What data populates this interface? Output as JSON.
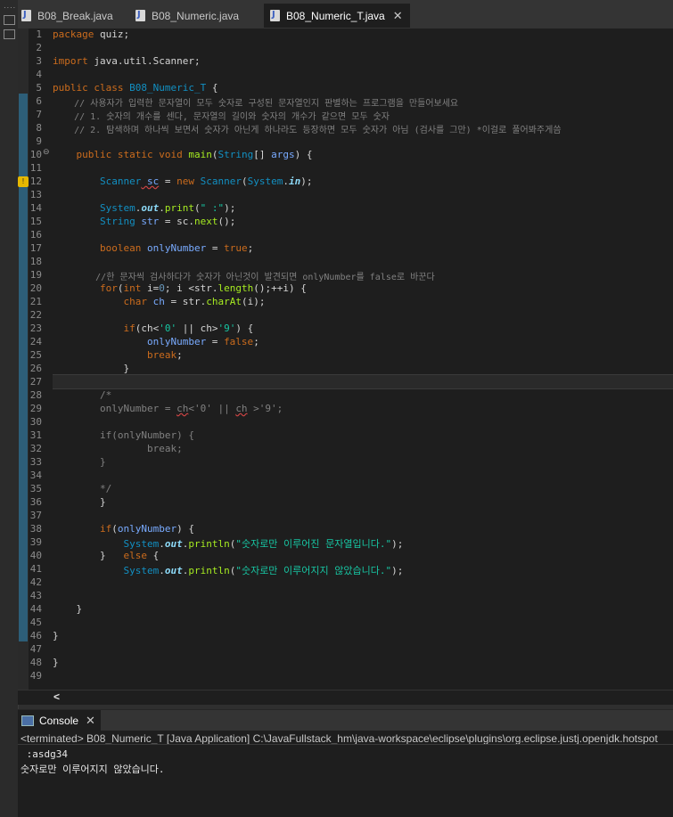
{
  "tabs": [
    {
      "label": "B08_Break.java",
      "active": false
    },
    {
      "label": "B08_Numeric.java",
      "active": false
    },
    {
      "label": "B08_Numeric_T.java",
      "active": true,
      "close": "✕"
    }
  ],
  "editor": {
    "line_numbers": [
      "1",
      "2",
      "3",
      "4",
      "5",
      "6",
      "7",
      "8",
      "9",
      "10",
      "11",
      "12",
      "13",
      "14",
      "15",
      "16",
      "17",
      "18",
      "19",
      "20",
      "21",
      "22",
      "23",
      "24",
      "25",
      "26",
      "27",
      "28",
      "29",
      "30",
      "31",
      "32",
      "33",
      "34",
      "35",
      "36",
      "37",
      "38",
      "39",
      "40",
      "41",
      "42",
      "43",
      "44",
      "45",
      "46",
      "47",
      "48",
      "49"
    ],
    "code": {
      "l1_kw": "package",
      "l1_rest": " quiz;",
      "l3_kw": "import",
      "l3_rest": " java.util.Scanner;",
      "l5_kw": "public class",
      "l5_cls": " B08_Numeric_T",
      "l5_rest": " {",
      "l6": "    // 사용자가 입력한 문자열이 모두 숫자로 구성된 문자열인지 판별하는 프로그램을 만들어보세요",
      "l7": "    // 1. 숫자의 개수를 센다, 문자열의 길이와 숫자의 개수가 같으면 모두 숫자",
      "l8": "    // 2. 탐색하며 하나씩 보면서 숫자가 아닌게 하나라도 등장하면 모두 숫자가 아님 (검사를 그만) *이걸로 풀어봐주게씀",
      "l10_kw": "    public static void",
      "l10_fn": " main",
      "l10_p1": "(",
      "l10_ty": "String",
      "l10_p2": "[] ",
      "l10_arg": "args",
      "l10_p3": ") {",
      "l12_ty": "        Scanner",
      "l12_var": " sc",
      "l12_p1": " = ",
      "l12_kw": "new",
      "l12_ty2": " Scanner",
      "l12_p2": "(",
      "l12_cls": "System",
      "l12_p3": ".",
      "l12_fld": "in",
      "l12_p4": ");",
      "l14_cls": "        System",
      "l14_p1": ".",
      "l14_fld": "out",
      "l14_p2": ".",
      "l14_fn": "print",
      "l14_p3": "(",
      "l14_st": "\" :\"",
      "l14_p4": ");",
      "l15_ty": "        String",
      "l15_var": " str",
      "l15_p1": " = sc.",
      "l15_fn": "next",
      "l15_p2": "();",
      "l17_kw": "        boolean",
      "l17_var": " onlyNumber",
      "l17_p1": " = ",
      "l17_kw2": "true",
      "l17_p2": ";",
      "l19": "        //한 문자씩 검사하다가 숫자가 아닌것이 발견되면 onlyNumber를 false로 바꾼다",
      "l20_kw": "        for",
      "l20_p1": "(",
      "l20_kw2": "int",
      "l20_p2": " i=",
      "l20_num": "0",
      "l20_p3": "; i <str.",
      "l20_fn": "length",
      "l20_p4": "();++i) {",
      "l21_kw": "            char",
      "l21_var": " ch",
      "l21_p1": " = str.",
      "l21_fn": "charAt",
      "l21_p2": "(i);",
      "l23_kw": "            if",
      "l23_p1": "(ch<",
      "l23_st": "'0'",
      "l23_p2": " || ch>",
      "l23_st2": "'9'",
      "l23_p3": ") {",
      "l24_var": "                onlyNumber",
      "l24_p1": " = ",
      "l24_kw": "false",
      "l24_p2": ";",
      "l25_kw": "                break",
      "l25_p1": ";",
      "l26": "            }",
      "l28": "        /*",
      "l29_a": "        onlyNumber = ",
      "l29_b": "ch",
      "l29_c": "<'0' || ",
      "l29_d": "ch",
      "l29_e": " >'9';",
      "l31": "        if(onlyNumber) {",
      "l32": "                break;",
      "l33": "        }",
      "l35": "        */",
      "l36": "        }",
      "l38_kw": "        if",
      "l38_p1": "(",
      "l38_var": "onlyNumber",
      "l38_p2": ") {",
      "l39_cls": "            System",
      "l39_p1": ".",
      "l39_fld": "out",
      "l39_p2": ".",
      "l39_fn": "println",
      "l39_p3": "(",
      "l39_st": "\"숫자로만 이루어진 문자열입니다.\"",
      "l39_p4": ");",
      "l40_p1": "        }   ",
      "l40_kw": "else",
      "l40_p2": " {",
      "l41_cls": "            System",
      "l41_p1": ".",
      "l41_fld": "out",
      "l41_p2": ".",
      "l41_fn": "println",
      "l41_p3": "(",
      "l41_st": "\"숫자로만 이루어지지 않았습니다.\"",
      "l41_p4": ");",
      "l44": "    }",
      "l46": "}",
      "l48": "}"
    }
  },
  "hscroll_arrow": "<",
  "console": {
    "tab_label": "Console",
    "close": "✕",
    "status": "<terminated> B08_Numeric_T [Java Application] C:\\JavaFullstack_hm\\java-workspace\\eclipse\\plugins\\org.eclipse.justj.openjdk.hotspot",
    "output": [
      " :asdg34",
      "숫자로만 이루어지지 않았습니다."
    ]
  }
}
